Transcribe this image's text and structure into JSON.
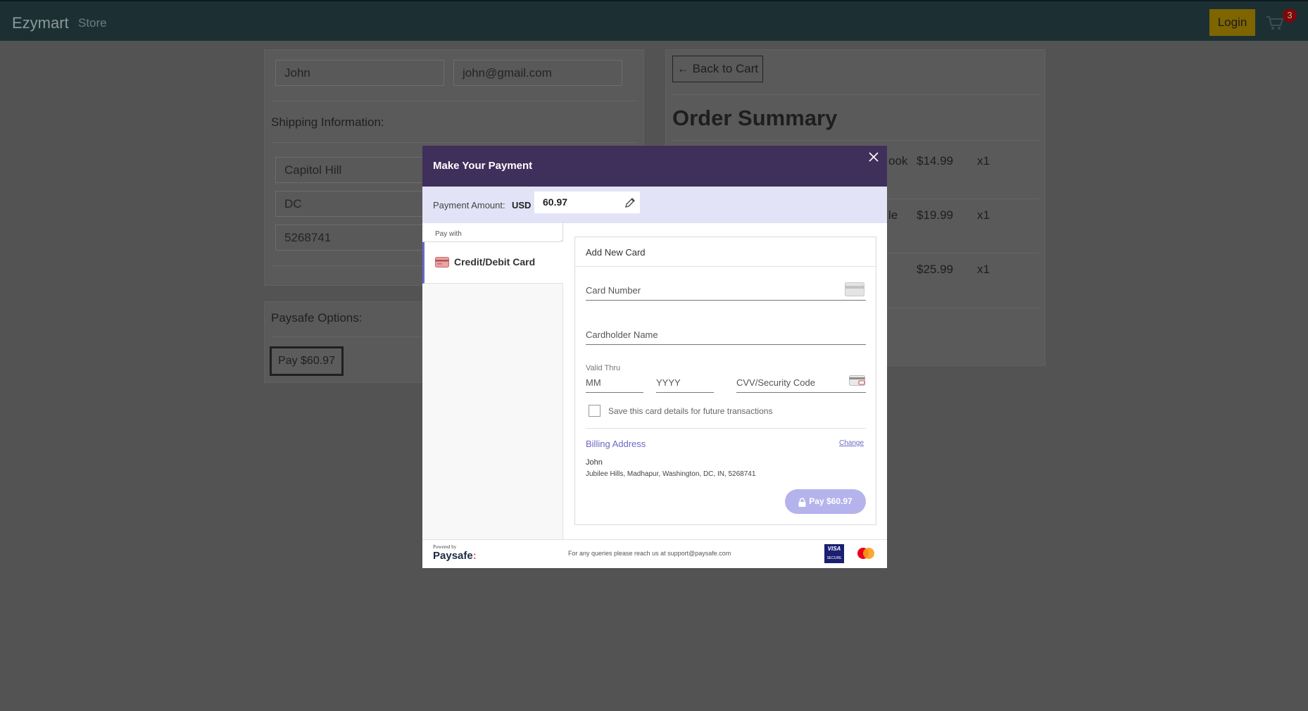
{
  "navbar": {
    "brand": "Ezymart",
    "store_link": "Store",
    "login_label": "Login",
    "cart_count": "3",
    "cart_icon": "cart-icon"
  },
  "customer": {
    "name": "John",
    "email": "john@gmail.com"
  },
  "shipping": {
    "heading": "Shipping Information:",
    "city": "Capitol Hill",
    "state": "DC",
    "zip": "5268741"
  },
  "paysafe_options": {
    "heading": "Paysafe Options:",
    "pay_label": "Pay $60.97"
  },
  "order": {
    "back_label": "← Back to Cart",
    "title": "Order Summary",
    "items": [
      {
        "name_fragment": "ook",
        "price": "$14.99",
        "qty": "x1"
      },
      {
        "name_fragment": "le",
        "price": "$19.99",
        "qty": "x1"
      },
      {
        "name_fragment": "",
        "price": "$25.99",
        "qty": "x1"
      }
    ]
  },
  "modal": {
    "title": "Make Your Payment",
    "close_icon": "close-icon",
    "amount_label": "Payment Amount:",
    "currency": "USD",
    "amount": "60.97",
    "pay_with": "Pay with",
    "method_label": "Credit/Debit Card",
    "form": {
      "title": "Add New Card",
      "card_number_placeholder": "Card Number",
      "cardholder_placeholder": "Cardholder Name",
      "valid_thru": "Valid Thru",
      "month_placeholder": "MM",
      "year_placeholder": "YYYY",
      "cvv_placeholder": "CVV/Security Code",
      "save_card_label": "Save this card details for future transactions",
      "billing_title": "Billing Address",
      "change_label": "Change",
      "billing_name": "John",
      "billing_address": "Jubilee Hills, Madhapur, Washington, DC, IN, 5268741",
      "pay_label": "Pay $60.97"
    },
    "footer": {
      "powered_by": "Powered by",
      "brand": "Paysafe",
      "brand_mark": ":",
      "support": "For any queries please reach us at support@paysafe.com",
      "visa_top": "VISA",
      "visa_bottom": "SECURE"
    }
  },
  "colors": {
    "modal_header": "#3f2f5b",
    "accent": "#6a67c7",
    "pay_button": "#b5b3ec"
  }
}
